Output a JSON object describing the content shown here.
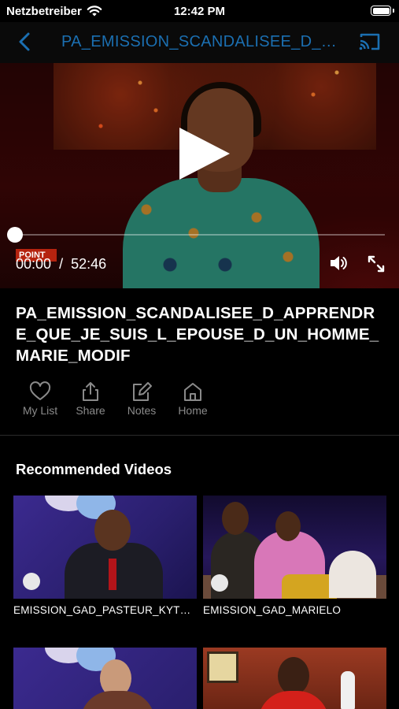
{
  "status_bar": {
    "carrier": "Netzbetreiber",
    "time": "12:42 PM",
    "wifi_icon": "wifi-icon",
    "battery_icon": "battery-icon"
  },
  "nav": {
    "back_icon": "chevron-left-icon",
    "title": "PA_EMISSION_SCANDALISEE_D_APPREND",
    "cast_icon": "cast-icon",
    "title_color": "#1b6fb1"
  },
  "player": {
    "current_time": "00:00",
    "separator": "/",
    "duration": "52:46",
    "progress": 0,
    "channel_logo_text": "POINT",
    "play_icon": "play-icon",
    "volume_icon": "volume-icon",
    "fullscreen_icon": "fullscreen-icon"
  },
  "video": {
    "title": "PA_EMISSION_SCANDALISEE_D_APPRENDRE_QUE_JE_SUIS_L_EPOUSE_D_UN_HOMME_MARIE_MODIF"
  },
  "actions": [
    {
      "label": "My List",
      "icon": "heart-icon"
    },
    {
      "label": "Share",
      "icon": "share-icon"
    },
    {
      "label": "Notes",
      "icon": "edit-icon"
    },
    {
      "label": "Home",
      "icon": "home-icon"
    }
  ],
  "recommended": {
    "title": "Recommended Videos",
    "items": [
      {
        "caption": "EMISSION_GAD_PASTEUR_KYTSHIMBA"
      },
      {
        "caption": "EMISSION_GAD_MARIELO"
      },
      {
        "caption": ""
      },
      {
        "caption": ""
      }
    ]
  },
  "colors": {
    "background": "#000000",
    "accent": "#1b6fb1",
    "action_gray": "#8a8a8a"
  }
}
